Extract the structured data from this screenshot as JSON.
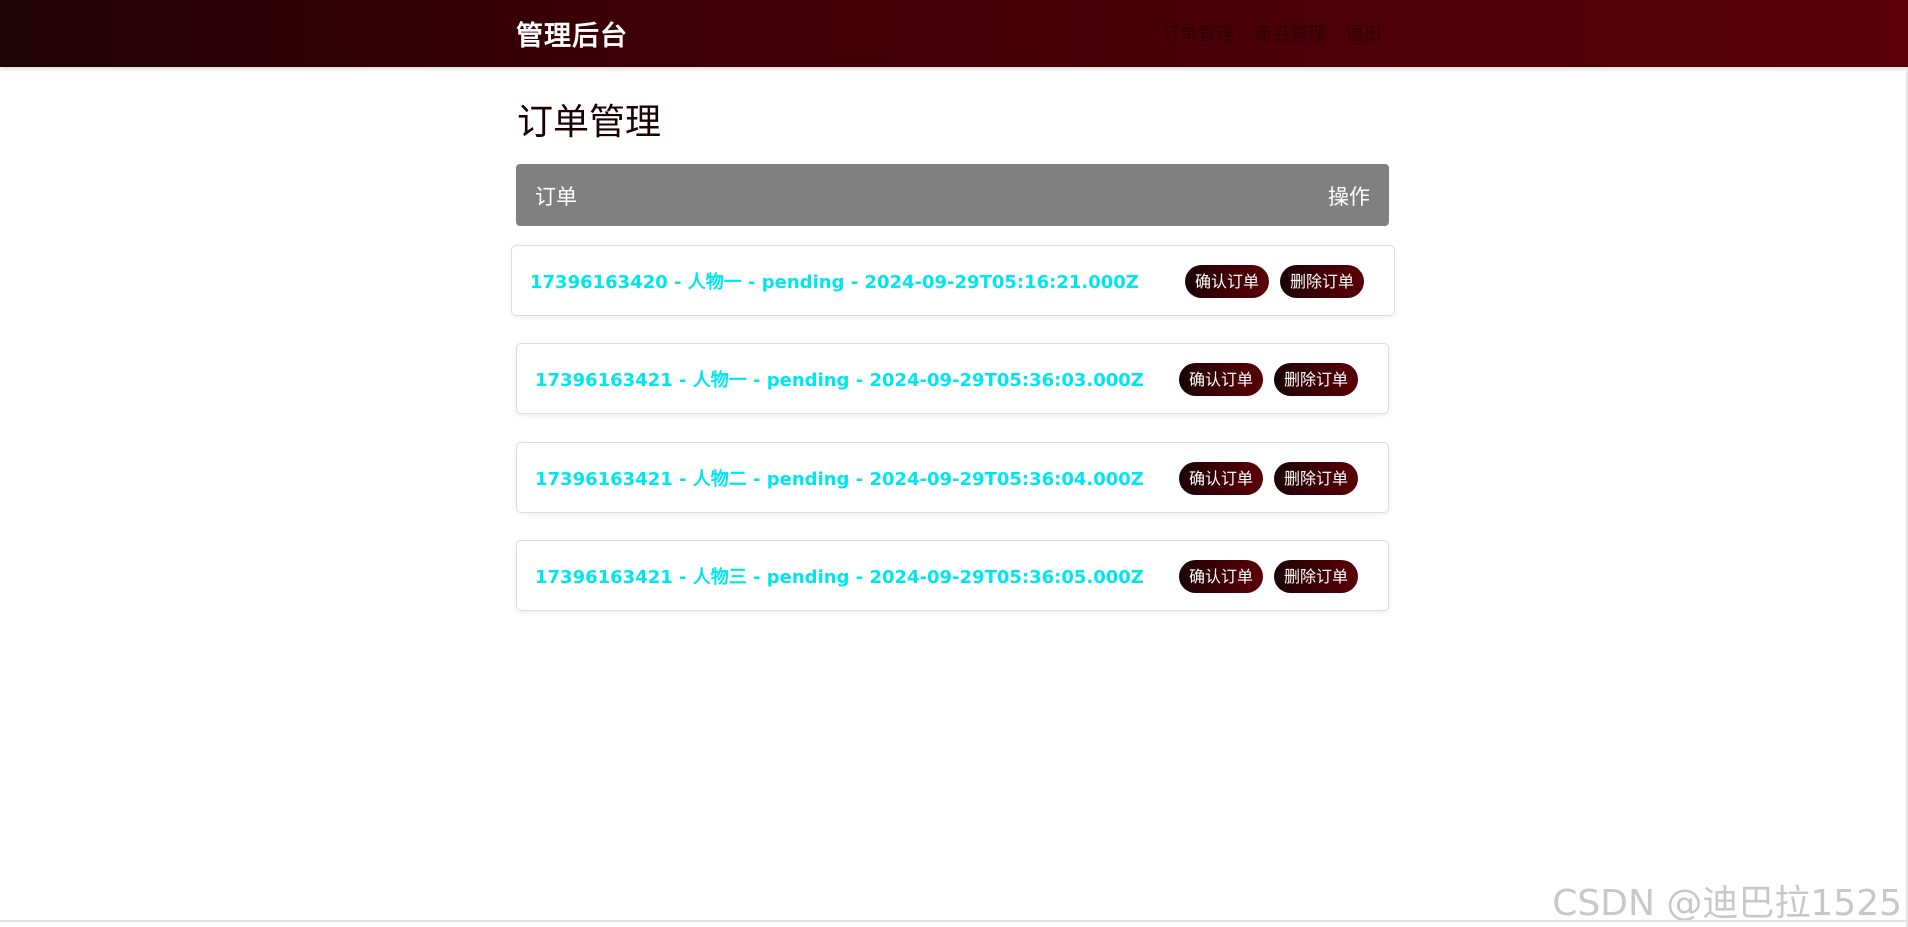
{
  "header": {
    "brand": "管理后台",
    "nav": [
      {
        "label": "订单管理"
      },
      {
        "label": "商品管理"
      },
      {
        "label": "退出"
      }
    ]
  },
  "main": {
    "title": "订单管理",
    "table_header": {
      "order_col": "订单",
      "action_col": "操作"
    },
    "orders": [
      {
        "text": "17396163420 - 人物一 - pending - 2024-09-29T05:16:21.000Z",
        "confirm_label": "确认订单",
        "delete_label": "删除订单"
      },
      {
        "text": "17396163421 - 人物一 - pending - 2024-09-29T05:36:03.000Z",
        "confirm_label": "确认订单",
        "delete_label": "删除订单"
      },
      {
        "text": "17396163421 - 人物二 - pending - 2024-09-29T05:36:04.000Z",
        "confirm_label": "确认订单",
        "delete_label": "删除订单"
      },
      {
        "text": "17396163421 - 人物三 - pending - 2024-09-29T05:36:05.000Z",
        "confirm_label": "确认订单",
        "delete_label": "删除订单"
      }
    ]
  },
  "watermark": "CSDN @迪巴拉1525",
  "colors": {
    "header_start": "#1e0206",
    "header_end": "#5a0006",
    "order_text": "#00e6ee",
    "table_header_bg": "#808080"
  }
}
